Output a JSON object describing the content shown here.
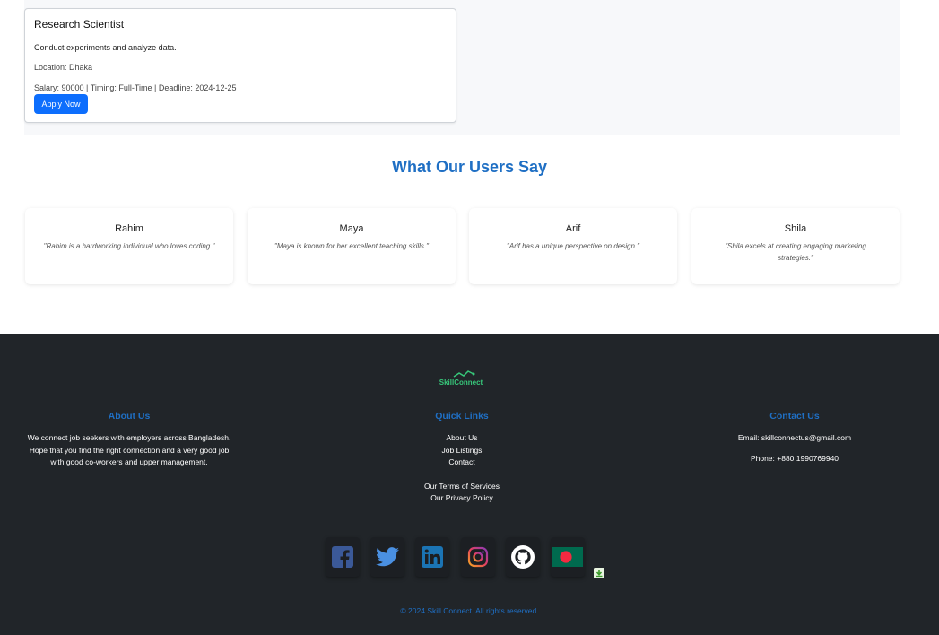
{
  "job": {
    "title": "Research Scientist",
    "description": "Conduct experiments and analyze data.",
    "location": "Location: Dhaka",
    "meta": "Salary: 90000 | Timing: Full-Time | Deadline: 2024-12-25",
    "apply_label": "Apply Now"
  },
  "testimonials": {
    "title": "What Our Users Say",
    "items": [
      {
        "name": "Rahim",
        "quote": "\"Rahim is a hardworking individual who loves coding.\""
      },
      {
        "name": "Maya",
        "quote": "\"Maya is known for her excellent teaching skills.\""
      },
      {
        "name": "Arif",
        "quote": "\"Arif has a unique perspective on design.\""
      },
      {
        "name": "Shila",
        "quote": "\"Shila excels at creating engaging marketing strategies.\""
      }
    ]
  },
  "footer": {
    "logo_text": "SkillConnect",
    "about": {
      "heading": "About Us",
      "text": "We connect job seekers with employers across Bangladesh. Hope that you find the right connection and a very good job with good co-workers and upper management."
    },
    "links": {
      "heading": "Quick Links",
      "items": [
        "About Us",
        "Job Listings",
        "Contact"
      ],
      "legal": [
        "Our Terms of Services",
        "Our Privacy Policy"
      ]
    },
    "contact": {
      "heading": "Contact Us",
      "email": "Email: skillconnectus@gmail.com",
      "phone": "Phone: +880 1990769940"
    },
    "social": [
      "facebook-icon",
      "twitter-icon",
      "linkedin-icon",
      "instagram-icon",
      "github-icon",
      "bangladesh-flag-icon"
    ],
    "copyright": "© 2024 Skill Connect. All rights reserved."
  },
  "colors": {
    "primary": "#0d6efd",
    "heading_blue": "#1f6fc4",
    "footer_bg": "#212529",
    "logo_green": "#37c77a"
  }
}
